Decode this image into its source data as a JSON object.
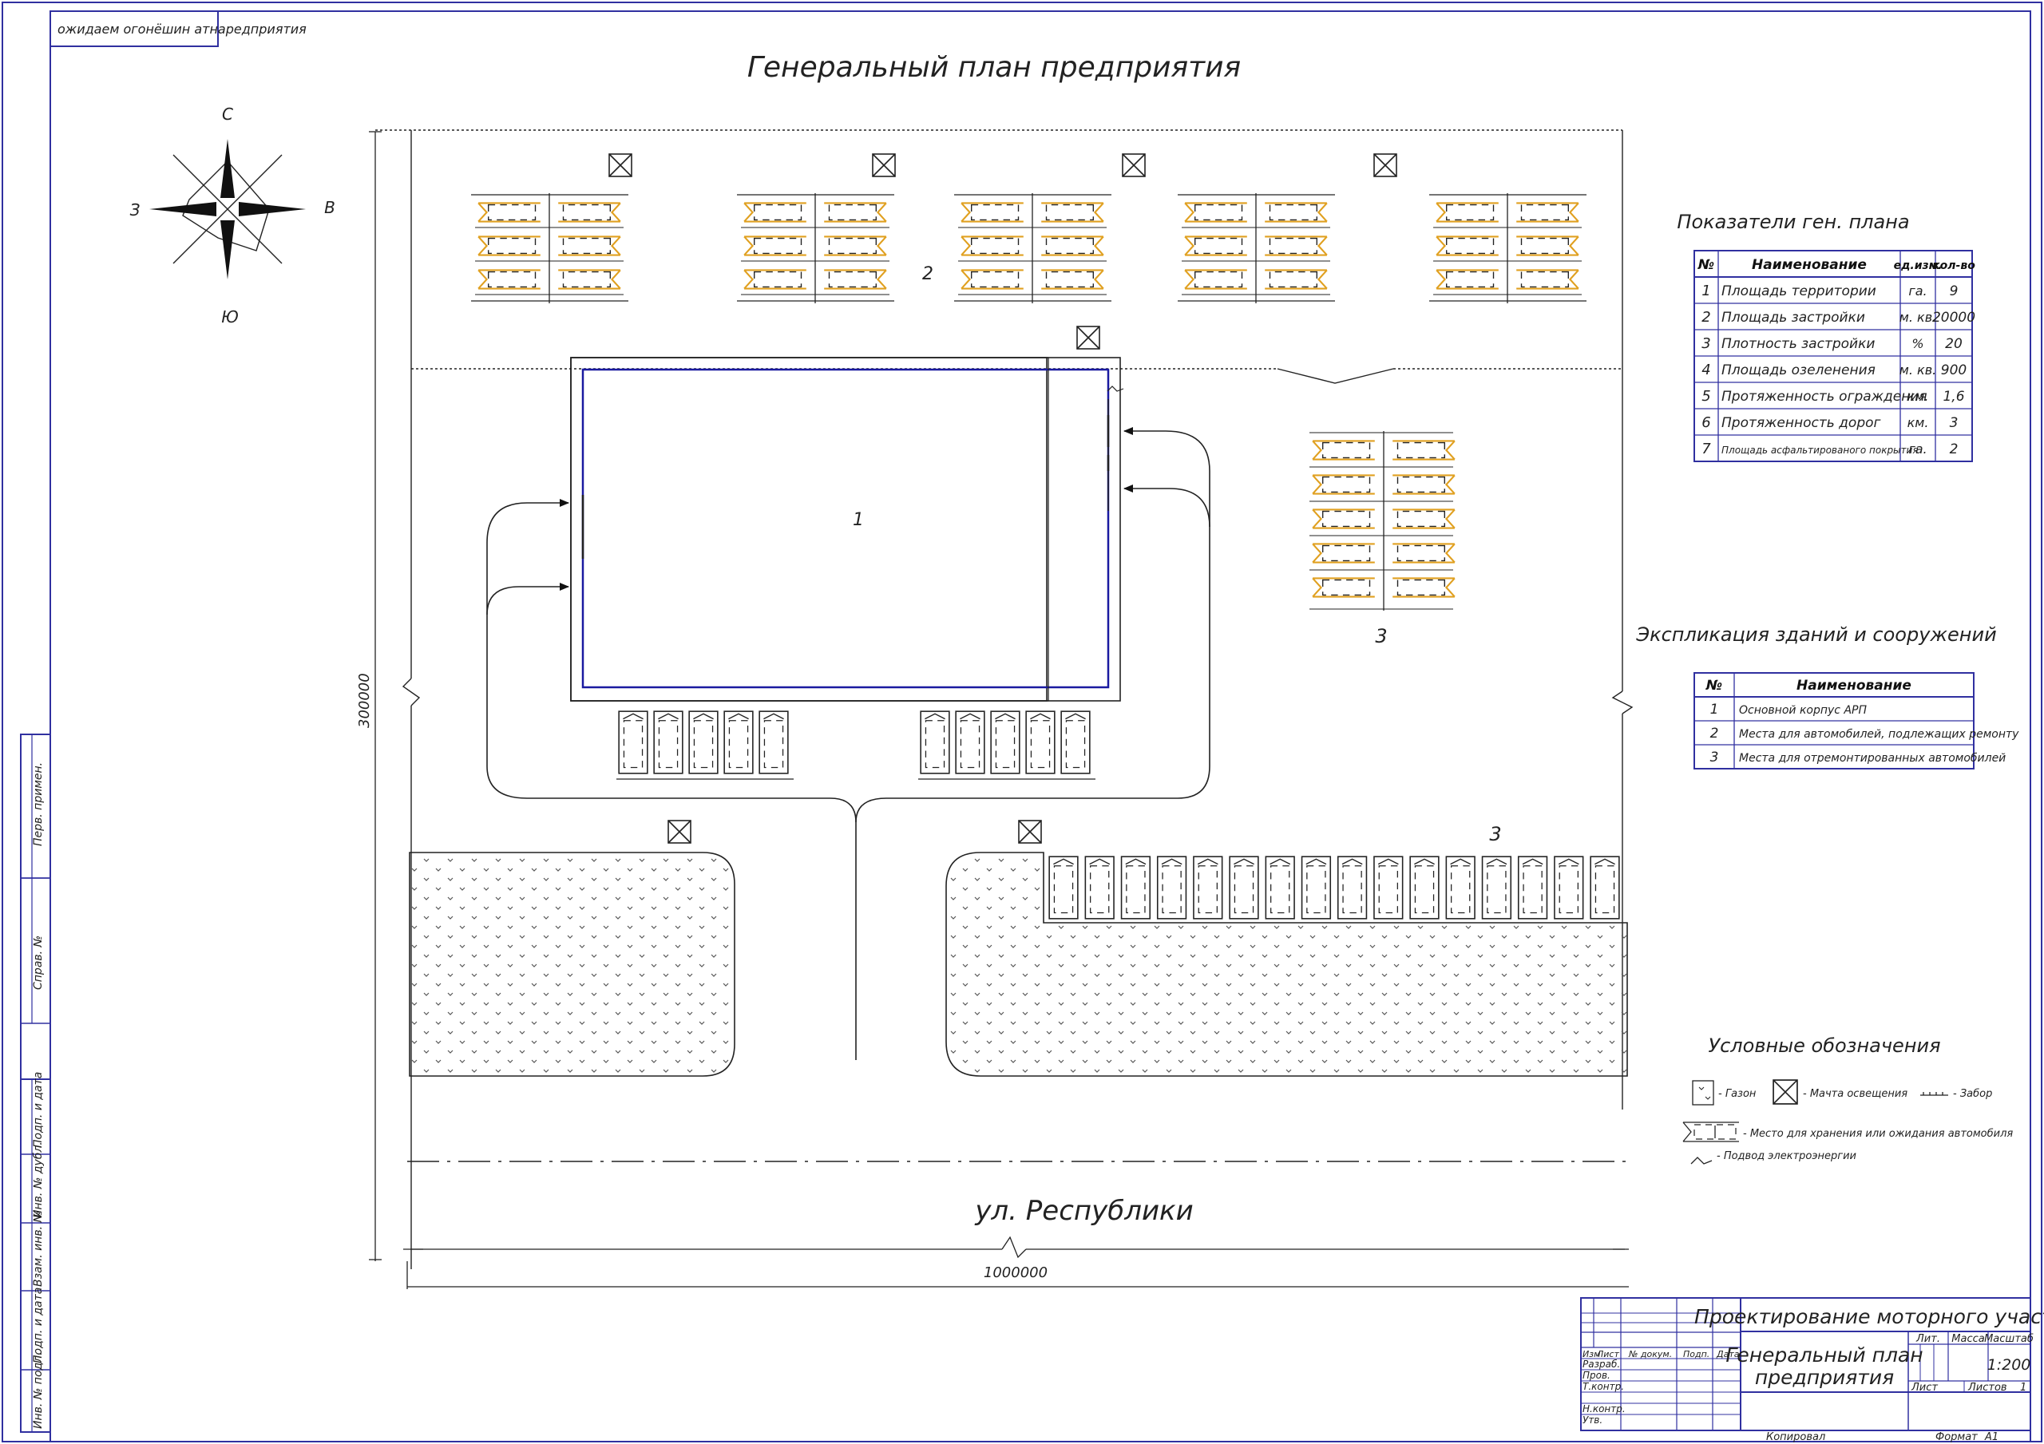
{
  "title": "Генеральный план предприятия",
  "stamp_top_left": "ожидаем огонёшин атнаредприятия",
  "compass": {
    "north": "С",
    "south": "Ю",
    "west": "З",
    "east": "В"
  },
  "dimensions": {
    "vertical": "300000",
    "horizontal": "1000000"
  },
  "street": "ул. Республики",
  "labels": {
    "main_building": "1",
    "repair_parking": "2",
    "ready_parking_right": "3",
    "ready_parking_bottom": "3"
  },
  "indicators": {
    "title": "Показатели ген. плана",
    "headers": [
      "№",
      "Наименование",
      "ед.изм.",
      "кол-во"
    ],
    "rows": [
      [
        "1",
        "Площадь территории",
        "га.",
        "9"
      ],
      [
        "2",
        "Площадь застройки",
        "м. кв.",
        "20000"
      ],
      [
        "3",
        "Плотность застройки",
        "%",
        "20"
      ],
      [
        "4",
        "Площадь озеленения",
        "м. кв.",
        "900"
      ],
      [
        "5",
        "Протяженность ограждения",
        "км.",
        "1,6"
      ],
      [
        "6",
        "Протяженность дорог",
        "км.",
        "3"
      ],
      [
        "7",
        "Площадь асфальтированого покрытия",
        "га.",
        "2"
      ]
    ]
  },
  "explication": {
    "title": "Экспликация зданий и сооружений",
    "headers": [
      "№",
      "Наименование"
    ],
    "rows": [
      [
        "1",
        "Основной корпус АРП"
      ],
      [
        "2",
        "Места для автомобилей, подлежащих ремонту"
      ],
      [
        "3",
        "Места для отремонтированных автомобилей"
      ]
    ]
  },
  "legend": {
    "title": "Условные обозначения",
    "items": {
      "lawn": "- Газон",
      "light_mast": "- Мачта освещения",
      "fence": "- Забор",
      "car_place": "- Место для хранения или ожидания автомобиля",
      "power": "- Подвод электроэнергии"
    }
  },
  "title_block": {
    "project": "Проектирование моторного участка",
    "drawing_name_line1": "Генеральный план",
    "drawing_name_line2": "предприятия",
    "col_headers": [
      "Изм",
      "Лист",
      "№ докум.",
      "Подп.",
      "Дата"
    ],
    "roles": [
      "Разраб.",
      "Пров.",
      "Т.контр.",
      "Н.контр.",
      "Утв."
    ],
    "lit": "Лит.",
    "mass": "Масса",
    "scale_label": "Масштаб",
    "scale": "1:200",
    "sheet": "Лист",
    "sheets": "Листов",
    "sheets_count": "1",
    "copied": "Копировал",
    "format_label": "Формат",
    "format": "A1"
  },
  "side_stamp": [
    "Перв. примен.",
    "Справ. №",
    "Подп. и дата",
    "Инв. № дубл.",
    "Взам. инв. №",
    "Подп. и дата",
    "Инв. № подл."
  ]
}
